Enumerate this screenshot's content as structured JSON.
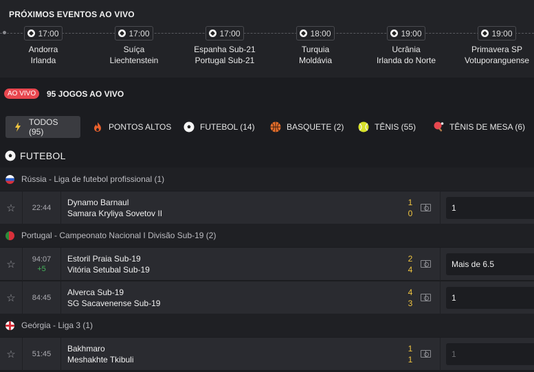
{
  "upcoming": {
    "title": "PRÓXIMOS EVENTOS AO VIVO",
    "events": [
      {
        "time": "17:00",
        "home": "Andorra",
        "away": "Irlanda"
      },
      {
        "time": "17:00",
        "home": "Suíça",
        "away": "Liechtenstein"
      },
      {
        "time": "17:00",
        "home": "Espanha Sub-21",
        "away": "Portugal Sub-21"
      },
      {
        "time": "18:00",
        "home": "Turquia",
        "away": "Moldávia"
      },
      {
        "time": "19:00",
        "home": "Ucrânia",
        "away": "Irlanda do Norte"
      },
      {
        "time": "19:00",
        "home": "Primavera SP",
        "away": "Votuporanguense"
      }
    ]
  },
  "live": {
    "badge": "AO VIVO",
    "count_label": "95 JOGOS AO VIVO"
  },
  "tabs": [
    {
      "label": "TODOS (95)",
      "icon": "lightning-icon",
      "active": true
    },
    {
      "label": "PONTOS ALTOS",
      "icon": "flame-icon"
    },
    {
      "label": "FUTEBOL (14)",
      "icon": "soccer-ball-icon"
    },
    {
      "label": "BASQUETE (2)",
      "icon": "basketball-icon"
    },
    {
      "label": "TÊNIS (55)",
      "icon": "tennis-ball-icon"
    },
    {
      "label": "TÊNIS DE MESA (6)",
      "icon": "ping-pong-icon"
    }
  ],
  "section": {
    "title": "FUTEBOL",
    "icon": "soccer-ball-icon"
  },
  "leagues": [
    {
      "name": "Rússia - Liga de futebol profissional (1)",
      "flag": "russia-flag-icon",
      "matches": [
        {
          "time": "22:44",
          "extra": "",
          "home": "Dynamo Barnaul",
          "away": "Samara Kryliya Sovetov II",
          "home_score": "1",
          "away_score": "0",
          "odd": "1",
          "odd_disabled": false
        }
      ]
    },
    {
      "name": "Portugal - Campeonato Nacional I Divisão Sub-19 (2)",
      "flag": "portugal-flag-icon",
      "matches": [
        {
          "time": "94:07",
          "extra": "+5",
          "home": "Estoril Praia Sub-19",
          "away": "Vitória Setubal Sub-19",
          "home_score": "2",
          "away_score": "4",
          "odd": "Mais de 6.5",
          "odd_disabled": false
        },
        {
          "time": "84:45",
          "extra": "",
          "home": "Alverca Sub-19",
          "away": "SG Sacavenense Sub-19",
          "home_score": "4",
          "away_score": "3",
          "odd": "1",
          "odd_disabled": false
        }
      ]
    },
    {
      "name": "Geórgia - Liga 3 (1)",
      "flag": "georgia-flag-icon",
      "matches": [
        {
          "time": "51:45",
          "extra": "",
          "home": "Bakhmaro",
          "away": "Meshakhte Tkibuli",
          "home_score": "1",
          "away_score": "1",
          "odd": "1",
          "odd_disabled": true
        }
      ]
    }
  ]
}
